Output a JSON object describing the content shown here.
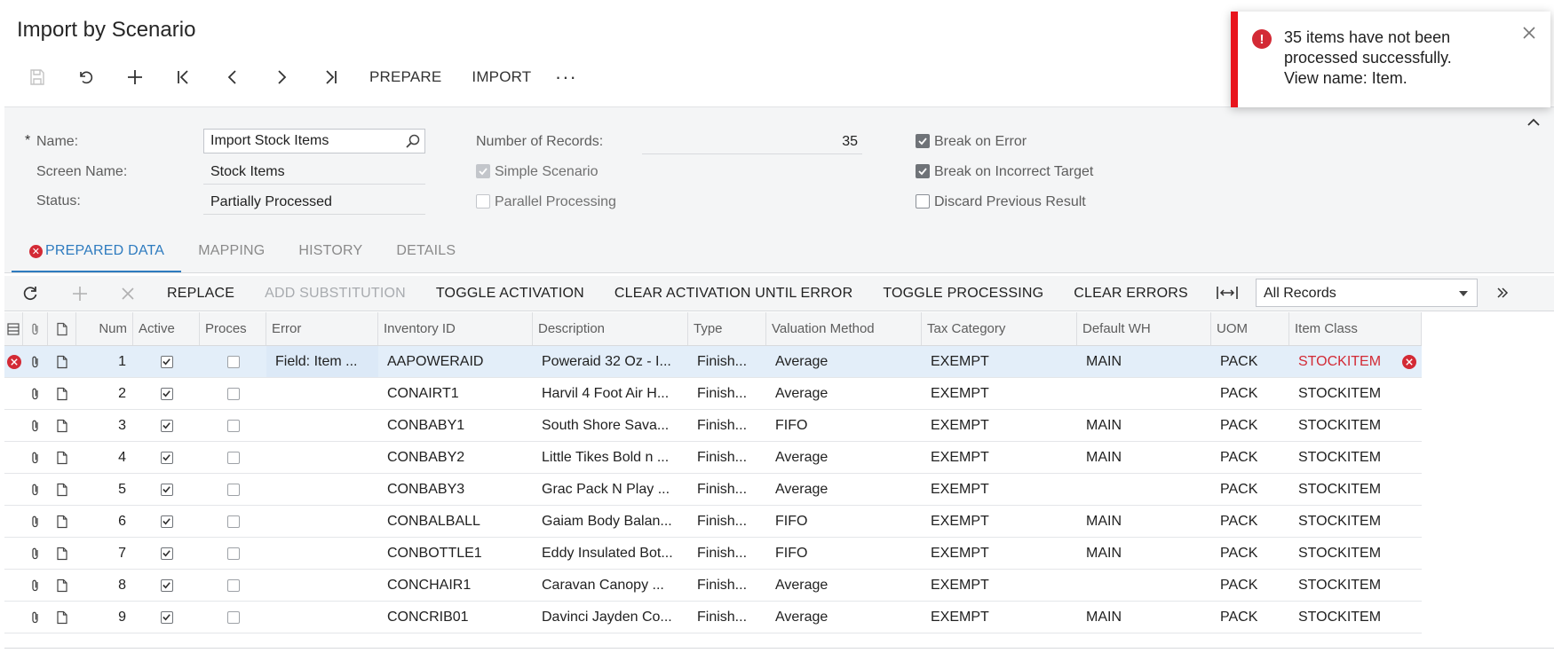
{
  "page": {
    "title": "Import by Scenario"
  },
  "toolbar": {
    "icons": [
      "save-icon",
      "undo-icon",
      "add-icon",
      "first-record-icon",
      "previous-record-icon",
      "next-record-icon",
      "last-record-icon"
    ],
    "prepare_label": "PREPARE",
    "import_label": "IMPORT",
    "more_label": "···"
  },
  "form": {
    "name_required_mark": "*",
    "name_label": "Name:",
    "name_value": "Import Stock Items",
    "screen_name_label": "Screen Name:",
    "screen_name_value": "Stock Items",
    "status_label": "Status:",
    "status_value": "Partially Processed",
    "records_label": "Number of Records:",
    "records_value": "35",
    "simple_scenario_label": "Simple Scenario",
    "simple_scenario_checked": true,
    "parallel_label": "Parallel Processing",
    "parallel_checked": false,
    "break_on_error_label": "Break on Error",
    "break_on_error_checked": true,
    "break_incorrect_label": "Break on Incorrect Target",
    "break_incorrect_checked": true,
    "discard_label": "Discard Previous Result",
    "discard_checked": false
  },
  "tabs": [
    {
      "label": "PREPARED DATA",
      "active": true,
      "has_error": true
    },
    {
      "label": "MAPPING",
      "active": false
    },
    {
      "label": "HISTORY",
      "active": false
    },
    {
      "label": "DETAILS",
      "active": false
    }
  ],
  "grid_toolbar": {
    "replace": "REPLACE",
    "add_substitution": "ADD SUBSTITUTION",
    "toggle_activation": "TOGGLE ACTIVATION",
    "clear_activation": "CLEAR ACTIVATION UNTIL ERROR",
    "toggle_processing": "TOGGLE PROCESSING",
    "clear_errors": "CLEAR ERRORS",
    "filter_value": "All Records"
  },
  "grid": {
    "headers": {
      "num": "Num",
      "active": "Active",
      "processed": "Proces",
      "error": "Error",
      "inventory_id": "Inventory ID",
      "description": "Description",
      "type": "Type",
      "valuation": "Valuation Method",
      "tax": "Tax Category",
      "wh": "Default WH",
      "uom": "UOM",
      "item_class": "Item Class"
    },
    "rows": [
      {
        "num": "1",
        "active": true,
        "processed": false,
        "error": "Field: Item ...",
        "inventory_id": "AAPOWERAID",
        "description": "Poweraid 32 Oz - I...",
        "type": "Finish...",
        "valuation": "Average",
        "tax": "EXEMPT",
        "wh": "MAIN",
        "uom": "PACK",
        "item_class": "STOCKITEM",
        "has_error": true
      },
      {
        "num": "2",
        "active": true,
        "processed": false,
        "error": "",
        "inventory_id": "CONAIRT1",
        "description": "Harvil 4 Foot Air H...",
        "type": "Finish...",
        "valuation": "Average",
        "tax": "EXEMPT",
        "wh": "",
        "uom": "PACK",
        "item_class": "STOCKITEM",
        "has_error": false
      },
      {
        "num": "3",
        "active": true,
        "processed": false,
        "error": "",
        "inventory_id": "CONBABY1",
        "description": "South Shore Sava...",
        "type": "Finish...",
        "valuation": "FIFO",
        "tax": "EXEMPT",
        "wh": "MAIN",
        "uom": "PACK",
        "item_class": "STOCKITEM",
        "has_error": false
      },
      {
        "num": "4",
        "active": true,
        "processed": false,
        "error": "",
        "inventory_id": "CONBABY2",
        "description": "Little Tikes Bold n ...",
        "type": "Finish...",
        "valuation": "Average",
        "tax": "EXEMPT",
        "wh": "MAIN",
        "uom": "PACK",
        "item_class": "STOCKITEM",
        "has_error": false
      },
      {
        "num": "5",
        "active": true,
        "processed": false,
        "error": "",
        "inventory_id": "CONBABY3",
        "description": "Grac Pack N Play ...",
        "type": "Finish...",
        "valuation": "Average",
        "tax": "EXEMPT",
        "wh": "",
        "uom": "PACK",
        "item_class": "STOCKITEM",
        "has_error": false
      },
      {
        "num": "6",
        "active": true,
        "processed": false,
        "error": "",
        "inventory_id": "CONBALBALL",
        "description": "Gaiam Body Balan...",
        "type": "Finish...",
        "valuation": "FIFO",
        "tax": "EXEMPT",
        "wh": "MAIN",
        "uom": "PACK",
        "item_class": "STOCKITEM",
        "has_error": false
      },
      {
        "num": "7",
        "active": true,
        "processed": false,
        "error": "",
        "inventory_id": "CONBOTTLE1",
        "description": "Eddy Insulated Bot...",
        "type": "Finish...",
        "valuation": "FIFO",
        "tax": "EXEMPT",
        "wh": "MAIN",
        "uom": "PACK",
        "item_class": "STOCKITEM",
        "has_error": false
      },
      {
        "num": "8",
        "active": true,
        "processed": false,
        "error": "",
        "inventory_id": "CONCHAIR1",
        "description": "Caravan Canopy ...",
        "type": "Finish...",
        "valuation": "Average",
        "tax": "EXEMPT",
        "wh": "",
        "uom": "PACK",
        "item_class": "STOCKITEM",
        "has_error": false
      },
      {
        "num": "9",
        "active": true,
        "processed": false,
        "error": "",
        "inventory_id": "CONCRIB01",
        "description": "Davinci Jayden Co...",
        "type": "Finish...",
        "valuation": "Average",
        "tax": "EXEMPT",
        "wh": "MAIN",
        "uom": "PACK",
        "item_class": "STOCKITEM",
        "has_error": false
      }
    ]
  },
  "toast": {
    "icon": "!",
    "message_line1": "35 items have not been processed successfully.",
    "message_line2": "View name: Item."
  },
  "colors": {
    "accent": "#2e7bbf",
    "error": "#d32a35",
    "toast_bar": "#e8141c",
    "selected_row": "#e3eef9"
  }
}
